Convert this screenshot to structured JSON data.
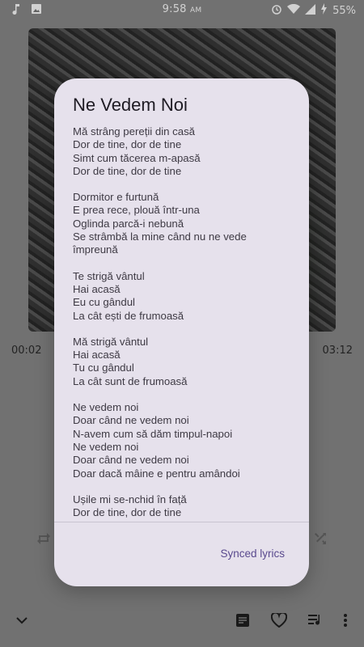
{
  "status_bar": {
    "time": "9:58",
    "ampm": "AM",
    "battery": "55%"
  },
  "player": {
    "current_time": "00:02",
    "total_time": "03:12"
  },
  "dialog": {
    "title": "Ne Vedem Noi",
    "stanzas": [
      [
        "Mă strâng pereții din casă",
        "Dor de tine, dor de tine",
        "Simt cum tăcerea m-apasă",
        "Dor de tine, dor de tine"
      ],
      [
        "Dormitor e furtună",
        "E prea rece, plouă într-una",
        "Oglinda parcă-i nebună",
        "Se strâmbă la mine când nu ne vede",
        "împreună"
      ],
      [
        "Te strigă vântul",
        "Hai acasă",
        "Eu cu gândul",
        "La cât ești de frumoasă"
      ],
      [
        "Mă strigă vântul",
        "Hai acasă",
        "Tu cu gândul",
        "La cât sunt de frumoasă"
      ],
      [
        "Ne vedem noi",
        "Doar când ne vedem noi",
        "N-avem cum să dăm timpul-napoi",
        "Ne vedem noi",
        "Doar când ne vedem noi",
        "Doar dacă mâine e pentru amândoi"
      ],
      [
        "Ușile mi se-nchid în față",
        "Dor de tine, dor de tine"
      ]
    ],
    "synced_lyrics_label": "Synced lyrics"
  }
}
